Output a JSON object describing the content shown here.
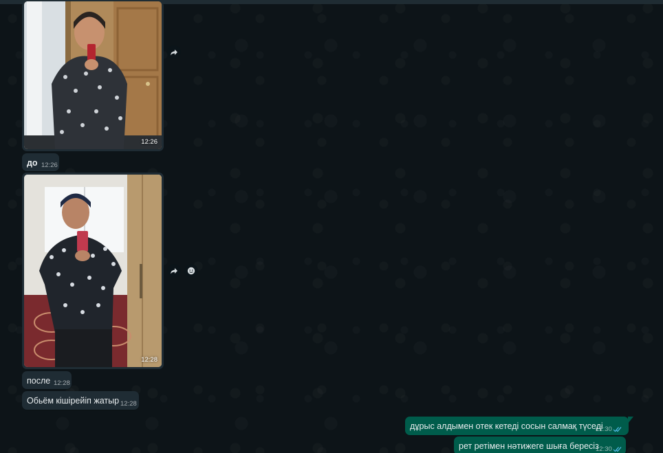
{
  "messages": {
    "photo1": {
      "time": "12:26"
    },
    "text1": {
      "text": "до",
      "time": "12:26"
    },
    "photo2": {
      "time": "12:28"
    },
    "text2": {
      "text": "после",
      "time": "12:28"
    },
    "text3": {
      "text": "Обьём кішірейіп жатыр",
      "time": "12:28"
    },
    "out1": {
      "text": "дұрыс алдымен отек кетеді  сосын салмақ түседі",
      "time": "12:30"
    },
    "out2": {
      "text": "рет ретімен нәтижеге шыға бересіз",
      "time": "12:30"
    }
  },
  "icons": {
    "forward": "forward-icon",
    "emoji": "emoji-reaction-icon",
    "read_receipt": "double-check-icon"
  },
  "colors": {
    "background": "#0d1418",
    "incoming_bubble": "#1f2c34",
    "outgoing_bubble": "#005c4b",
    "read_check": "#53bdeb"
  }
}
